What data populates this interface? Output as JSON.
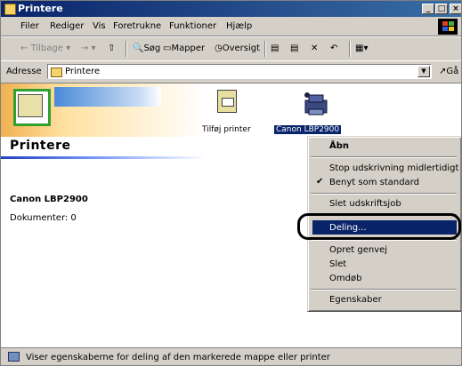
{
  "window": {
    "title": "Printere"
  },
  "menubar": {
    "items": [
      "Filer",
      "Rediger",
      "Vis",
      "Foretrukne",
      "Funktioner",
      "Hjælp"
    ]
  },
  "toolbar": {
    "back": "Tilbage",
    "search": "Søg",
    "folders": "Mapper",
    "history": "Oversigt"
  },
  "address": {
    "label": "Adresse",
    "value": "Printere",
    "go": "Gå"
  },
  "sidepanel": {
    "title": "Printere",
    "printer_name": "Canon LBP2900",
    "documents": "Dokumenter: 0"
  },
  "items": {
    "add_printer": "Tilføj printer",
    "canon": "Canon LBP2900"
  },
  "context_menu": {
    "open": "Åbn",
    "pause": "Stop udskrivning midlertidigt",
    "default": "Benyt som standard",
    "cancel_docs": "Slet udskriftsjob",
    "sharing": "Deling...",
    "shortcut": "Opret genvej",
    "delete": "Slet",
    "rename": "Omdøb",
    "properties": "Egenskaber"
  },
  "statusbar": {
    "text": "Viser egenskaberne for deling af den markerede mappe eller printer"
  }
}
